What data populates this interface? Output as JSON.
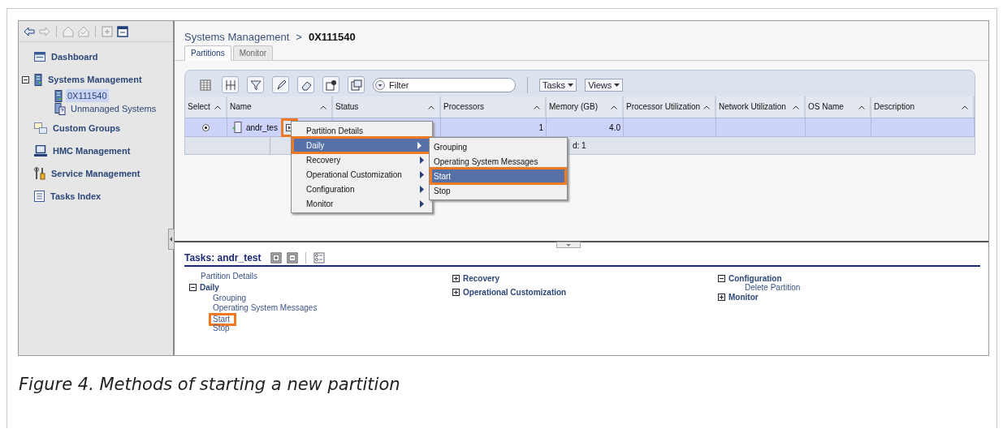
{
  "sidebar": {
    "items": [
      {
        "label": "Dashboard",
        "selected": false
      },
      {
        "label": "Systems Management",
        "selected": false,
        "expanded": true,
        "children": [
          {
            "label": "0X111540",
            "selected": true
          },
          {
            "label": "Unmanaged Systems",
            "selected": false
          }
        ]
      },
      {
        "label": "Custom Groups",
        "selected": false
      },
      {
        "label": "HMC Management",
        "selected": false
      },
      {
        "label": "Service Management",
        "selected": false
      },
      {
        "label": "Tasks Index",
        "selected": false
      }
    ]
  },
  "breadcrumb": {
    "parent": "Systems Management",
    "separator": ">",
    "current": "0X111540"
  },
  "tabs": [
    {
      "label": "Partitions",
      "selected": true
    },
    {
      "label": "Monitor",
      "selected": false
    }
  ],
  "toolbar": {
    "filter": {
      "placeholder": "Filter"
    },
    "menus": [
      "Tasks",
      "Views"
    ]
  },
  "table": {
    "columns": [
      "Select",
      "Name",
      "Status",
      "Processors",
      "Memory (GB)",
      "Processor Utilization",
      "Network Utilization",
      "OS Name",
      "Description"
    ],
    "rows": [
      {
        "selected": true,
        "name": "andr_tes",
        "processors": "1",
        "memory": "4.0",
        "menu_highlighted": true
      }
    ],
    "footer": "d: 1"
  },
  "context_menu": {
    "items": [
      {
        "label": "Partition Details",
        "submenu": false,
        "selected": false,
        "highlighted": false
      },
      {
        "label": "Daily",
        "submenu": true,
        "selected": true,
        "highlighted": true
      },
      {
        "label": "Recovery",
        "submenu": true,
        "selected": false,
        "highlighted": false
      },
      {
        "label": "Operational Customization",
        "submenu": true,
        "selected": false,
        "highlighted": false
      },
      {
        "label": "Configuration",
        "submenu": true,
        "selected": false,
        "highlighted": false
      },
      {
        "label": "Monitor",
        "submenu": true,
        "selected": false,
        "highlighted": false
      }
    ],
    "submenu": {
      "items": [
        {
          "label": "Grouping",
          "selected": false,
          "highlighted": false
        },
        {
          "label": "Operating System Messages",
          "selected": false,
          "highlighted": false
        },
        {
          "label": "Start",
          "selected": true,
          "highlighted": true
        },
        {
          "label": "Stop",
          "selected": false,
          "highlighted": false
        }
      ]
    }
  },
  "tasks": {
    "title": "Tasks: andr_test",
    "columns": [
      {
        "items": [
          {
            "kind": "link",
            "label": "Partition Details",
            "highlighted": false
          },
          {
            "kind": "group",
            "label": "Daily",
            "expanded": true,
            "children": [
              {
                "label": "Grouping",
                "highlighted": false
              },
              {
                "label": "Operating System Messages",
                "highlighted": false
              },
              {
                "label": "Start",
                "highlighted": true
              },
              {
                "label": "Stop",
                "highlighted": false
              }
            ]
          }
        ]
      },
      {
        "items": [
          {
            "kind": "group",
            "label": "Recovery",
            "expanded": false
          },
          {
            "kind": "group",
            "label": "Operational Customization",
            "expanded": false
          }
        ]
      },
      {
        "items": [
          {
            "kind": "group",
            "label": "Configuration",
            "expanded": true,
            "children": [
              {
                "label": "Delete Partition",
                "highlighted": false
              }
            ]
          },
          {
            "kind": "group",
            "label": "Monitor",
            "expanded": false
          }
        ]
      }
    ]
  },
  "caption": "Figure 4. Methods of starting a new partition"
}
